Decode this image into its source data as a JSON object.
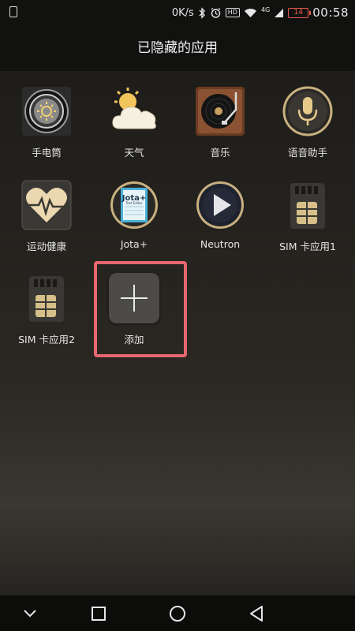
{
  "status_bar": {
    "speed": "0K/s",
    "network": "4G",
    "hd": "HD",
    "battery": "14",
    "time": "00:58"
  },
  "title": "已隐藏的应用",
  "apps": [
    {
      "label": "手电筒",
      "icon": "flashlight-icon"
    },
    {
      "label": "天气",
      "icon": "weather-icon"
    },
    {
      "label": "音乐",
      "icon": "music-icon"
    },
    {
      "label": "语音助手",
      "icon": "voice-assistant-icon"
    },
    {
      "label": "运动健康",
      "icon": "health-icon"
    },
    {
      "label": "Jota+",
      "icon": "jota-icon",
      "icon_text": "Jota+",
      "icon_subtext": "Text Editor"
    },
    {
      "label": "Neutron",
      "icon": "neutron-icon"
    },
    {
      "label": "SIM 卡应用1",
      "icon": "sim-card-icon"
    },
    {
      "label": "SIM 卡应用2",
      "icon": "sim-card-icon"
    }
  ],
  "add": {
    "label": "添加",
    "icon": "plus-icon"
  },
  "nav": {
    "back": "back-icon",
    "home": "home-icon",
    "recents": "recents-icon",
    "hide": "chevron-down-icon"
  },
  "colors": {
    "highlight": "#e8676f",
    "battery_low": "#e85c4a"
  }
}
